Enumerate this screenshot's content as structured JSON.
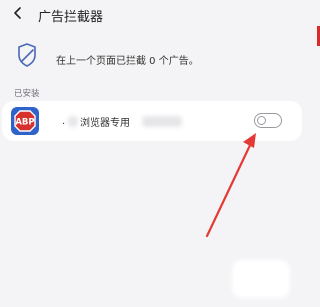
{
  "header": {
    "back_icon": "chevron-left-icon",
    "title": "广告拦截器"
  },
  "info": {
    "icon": "shield-icon",
    "text": "在上一个页面已拦截 0 个广告。"
  },
  "installed": {
    "section_label": "已安装",
    "extensions": [
      {
        "icon": "abp-logo",
        "icon_text": "ABP",
        "prefix": ".",
        "name": "浏览器专用",
        "enabled": false
      }
    ]
  },
  "colors": {
    "background": "#f4f4f6",
    "card": "#ffffff",
    "abp_red": "#d7312e",
    "annotation_arrow": "#e53935",
    "shield_blue": "#4a69b6"
  }
}
